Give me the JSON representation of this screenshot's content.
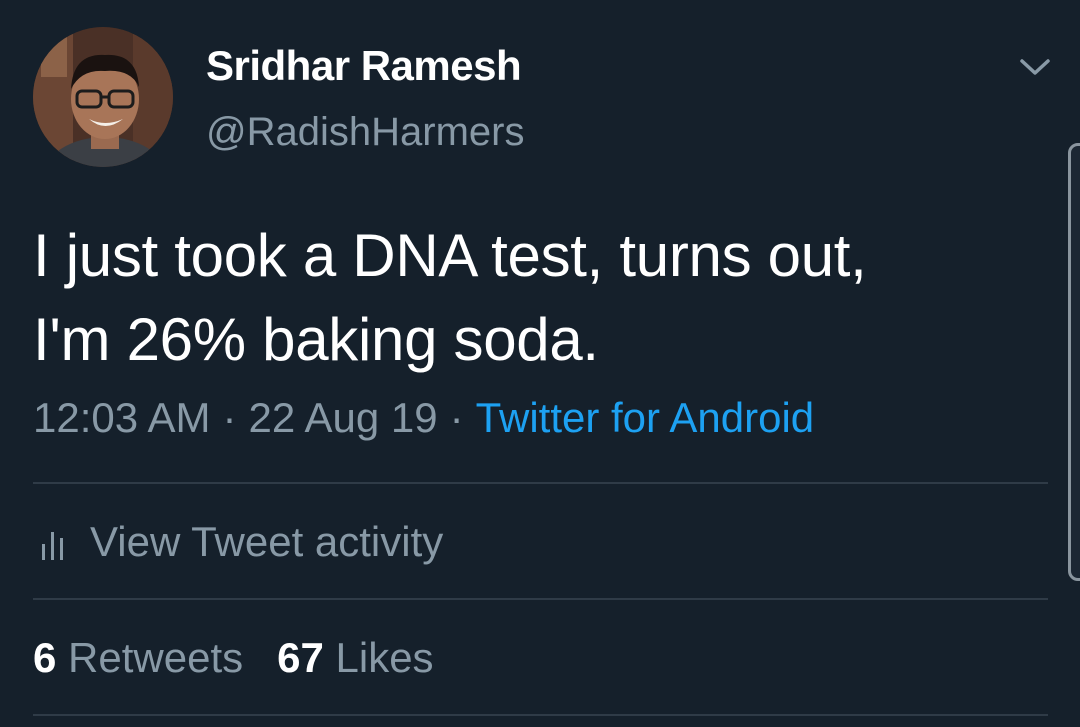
{
  "author": {
    "display_name": "Sridhar Ramesh",
    "handle": "@RadishHarmers"
  },
  "icons": {
    "menu": "chevron-down-icon",
    "activity": "bar-chart-icon",
    "avatar": "profile-photo"
  },
  "tweet": {
    "text_lines": [
      "I just took a DNA test, turns out,",
      "I'm 26% baking soda."
    ],
    "time": "12:03 AM",
    "separator": "·",
    "date": "22 Aug 19",
    "source": "Twitter for Android"
  },
  "activity": {
    "label": "View Tweet activity"
  },
  "stats": {
    "retweets_count": "6",
    "retweets_label": "Retweets",
    "likes_count": "67",
    "likes_label": "Likes"
  },
  "colors": {
    "background": "#15202b",
    "text_primary": "#ffffff",
    "text_secondary": "#8899a6",
    "link": "#1da1f2",
    "divider": "#2f3b47"
  }
}
